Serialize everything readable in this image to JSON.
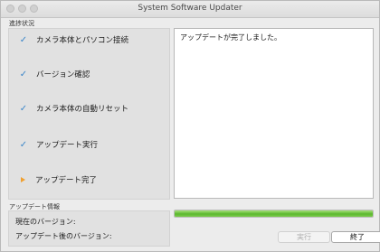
{
  "window": {
    "title": "System Software Updater"
  },
  "progress_section": {
    "label": "進捗状況",
    "steps": [
      {
        "label": "カメラ本体とパソコン接続",
        "status": "done",
        "icon": "checkmark-icon"
      },
      {
        "label": "バージョン確認",
        "status": "done",
        "icon": "checkmark-icon"
      },
      {
        "label": "カメラ本体の自動リセット",
        "status": "done",
        "icon": "checkmark-icon"
      },
      {
        "label": "アップデート実行",
        "status": "done",
        "icon": "checkmark-icon"
      },
      {
        "label": "アップデート完了",
        "status": "current",
        "icon": "arrow-right-icon"
      }
    ]
  },
  "log": {
    "text": "アップデートが完了しました。"
  },
  "info_section": {
    "label": "アップデート情報",
    "current_version_label": "現在のバージョン:",
    "current_version_value": "",
    "after_version_label": "アップデート後のバージョン:",
    "after_version_value": ""
  },
  "progress_bar": {
    "percent": 100,
    "color": "#5bb82e"
  },
  "buttons": {
    "run_label": "実行",
    "exit_label": "終了"
  },
  "colors": {
    "check": "#3b86c9",
    "current_arrow": "#f0a030"
  }
}
